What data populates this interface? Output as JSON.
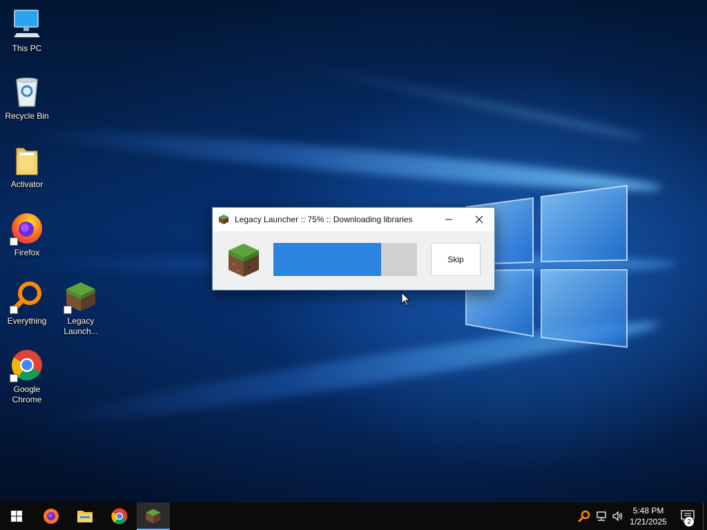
{
  "desktop": {
    "icons": [
      {
        "label": "This PC",
        "icon": "this-pc-icon"
      },
      {
        "label": "Recycle Bin",
        "icon": "recycle-bin-icon"
      },
      {
        "label": "Activator",
        "icon": "folder-icon"
      },
      {
        "label": "Firefox",
        "icon": "firefox-icon"
      },
      {
        "label": "Everything",
        "icon": "everything-search-icon"
      },
      {
        "label": "Legacy Launch...",
        "icon": "grass-block-icon"
      },
      {
        "label": "Google Chrome",
        "icon": "chrome-icon"
      }
    ]
  },
  "dialog": {
    "title": "Legacy Launcher :: 75% :: Downloading libraries",
    "progress_percent": 75,
    "skip_label": "Skip"
  },
  "taskbar": {
    "apps": [
      "start",
      "firefox",
      "file-explorer",
      "chrome",
      "legacy-launcher"
    ],
    "active_app": "legacy-launcher",
    "time": "5:48 PM",
    "date": "1/21/2025",
    "notification_count": "2"
  },
  "colors": {
    "progress_fill": "#2a84e0",
    "progress_track": "#d0d0d0",
    "taskbar": "#0b0b0c",
    "accent": "#6aaef6"
  }
}
